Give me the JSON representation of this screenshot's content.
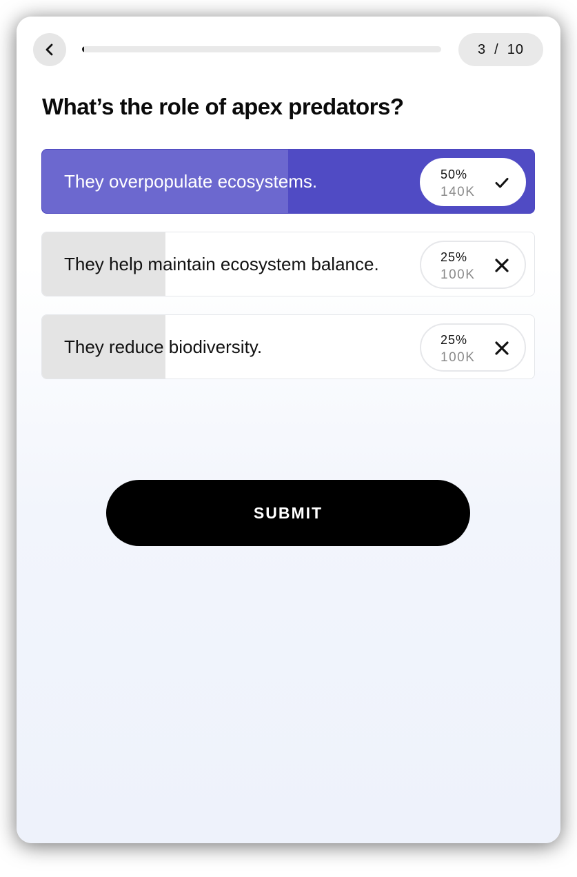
{
  "header": {
    "back_icon": "chevron-left-icon",
    "progress_fraction": 0.005,
    "counter_current": "3",
    "counter_sep": "/",
    "counter_total": "10"
  },
  "question": "What’s the role of apex predators?",
  "options": [
    {
      "label": "They overpopulate ecosystems.",
      "percent": "50%",
      "count": "140K",
      "share": 0.5,
      "selected": true,
      "icon": "checkmark-icon"
    },
    {
      "label": "They help maintain ecosystem balance.",
      "percent": "25%",
      "count": "100K",
      "share": 0.25,
      "selected": false,
      "icon": "close-icon"
    },
    {
      "label": "They reduce biodiversity.",
      "percent": "25%",
      "count": "100K",
      "share": 0.25,
      "selected": false,
      "icon": "close-icon"
    }
  ],
  "submit_label": "SUBMIT",
  "colors": {
    "accent": "#504bc4",
    "accent_fill": "#6c68cf",
    "submit_bg": "#000000"
  }
}
